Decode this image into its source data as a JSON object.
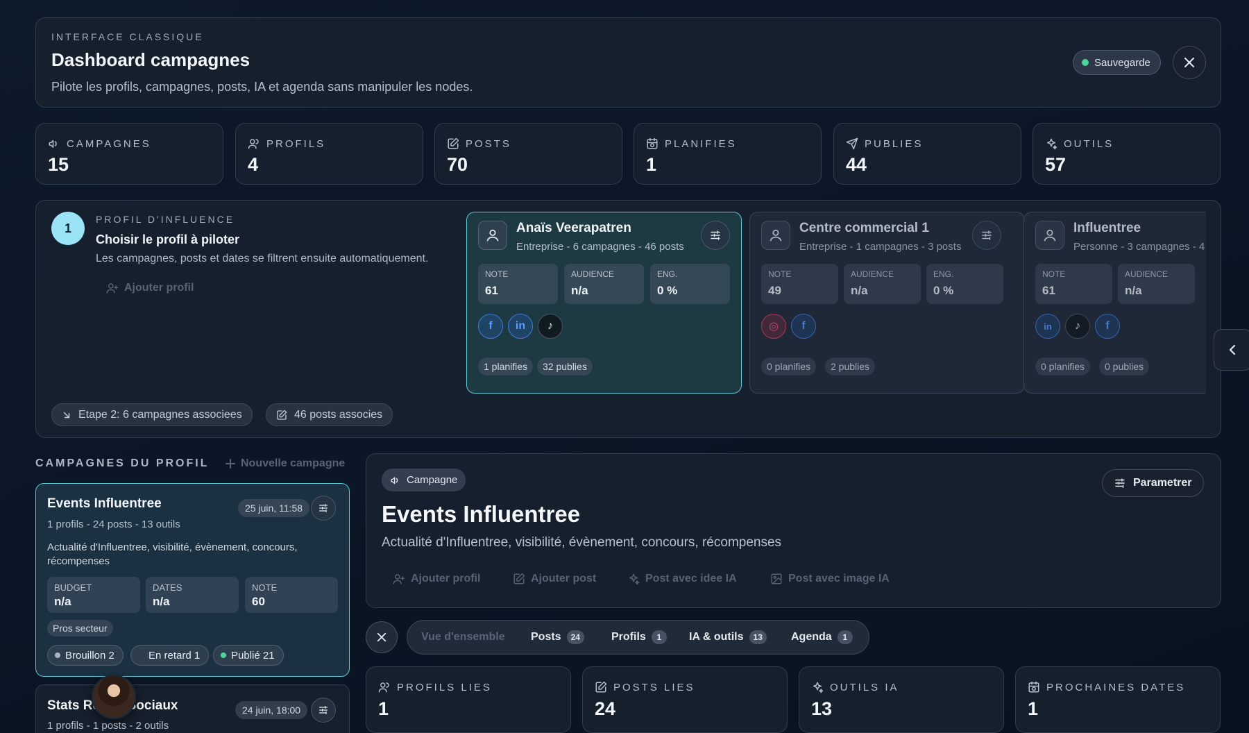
{
  "header": {
    "eyebrow": "INTERFACE CLASSIQUE",
    "title": "Dashboard campagnes",
    "subtitle": "Pilote les profils, campagnes, posts, IA et agenda sans manipuler les nodes.",
    "save_label": "Sauvegarde",
    "save_status_color": "#4cd59a"
  },
  "stats": [
    {
      "label": "CAMPAGNES",
      "value": "15",
      "icon": "megaphone-icon"
    },
    {
      "label": "PROFILS",
      "value": "4",
      "icon": "users-icon"
    },
    {
      "label": "POSTS",
      "value": "70",
      "icon": "edit-icon"
    },
    {
      "label": "PLANIFIES",
      "value": "1",
      "icon": "calendar-clock-icon"
    },
    {
      "label": "PUBLIES",
      "value": "44",
      "icon": "send-icon"
    },
    {
      "label": "OUTILS",
      "value": "57",
      "icon": "sparkles-icon"
    }
  ],
  "profile_section": {
    "step": "1",
    "eyebrow": "PROFIL D'INFLUENCE",
    "title": "Choisir le profil à piloter",
    "subtitle": "Les campagnes, posts et dates se filtrent ensuite automatiquement.",
    "add_label": "Ajouter profil",
    "step2_label": "Etape 2: 6 campagnes associees",
    "posts_label": "46 posts associes",
    "profiles": [
      {
        "name": "Anaïs Veerapatren",
        "meta": "Entreprise - 6 campagnes - 46 posts",
        "stats": [
          {
            "label": "NOTE",
            "value": "61"
          },
          {
            "label": "AUDIENCE",
            "value": "n/a"
          },
          {
            "label": "ENG.",
            "value": "0 %"
          }
        ],
        "socials": [
          "facebook",
          "linkedin",
          "tiktok"
        ],
        "chips": [
          "1 planifies",
          "32 publies"
        ]
      },
      {
        "name": "Centre commercial 1",
        "meta": "Entreprise - 1 campagnes - 3 posts",
        "stats": [
          {
            "label": "NOTE",
            "value": "49"
          },
          {
            "label": "AUDIENCE",
            "value": "n/a"
          },
          {
            "label": "ENG.",
            "value": "0 %"
          }
        ],
        "socials": [
          "instagram",
          "facebook"
        ],
        "chips": [
          "0 planifies",
          "2 publies"
        ]
      },
      {
        "name": "Influentree",
        "meta": "Personne - 3 campagnes - 4",
        "stats": [
          {
            "label": "NOTE",
            "value": "61"
          },
          {
            "label": "AUDIENCE",
            "value": "n/a"
          }
        ],
        "socials": [
          "linkedin",
          "tiktok",
          "facebook"
        ],
        "chips": [
          "0 planifies",
          "0 publies"
        ]
      }
    ]
  },
  "campaigns_list": {
    "heading": "CAMPAGNES DU PROFIL",
    "new_label": "Nouvelle campagne",
    "items": [
      {
        "title": "Events Influentree",
        "date": "25 juin, 11:58",
        "meta": "1 profils - 24 posts - 13 outils",
        "desc": "Actualité d'Influentree, visibilité, évènement, concours, récompenses",
        "stats": [
          {
            "label": "BUDGET",
            "value": "n/a"
          },
          {
            "label": "DATES",
            "value": "n/a"
          },
          {
            "label": "NOTE",
            "value": "60"
          }
        ],
        "tag": "Pros secteur",
        "statuses": [
          {
            "label": "Brouillon 2",
            "color": "#aab4c0"
          },
          {
            "label": "En retard 1",
            "color": ""
          },
          {
            "label": "Publié 21",
            "color": "#4cd59a"
          }
        ]
      },
      {
        "title": "Stats Re",
        "title_end": "t Sociaux",
        "date": "24 juin, 18:00",
        "meta": "1 profils - 1 posts - 2 outils"
      }
    ]
  },
  "campaign_detail": {
    "badge": "Campagne",
    "title": "Events Influentree",
    "desc": "Actualité d'Influentree, visibilité, évènement, concours, récompenses",
    "param_label": "Parametrer",
    "actions": [
      {
        "label": "Ajouter profil",
        "icon": "user-plus-icon"
      },
      {
        "label": "Ajouter post",
        "icon": "edit-icon"
      },
      {
        "label": "Post avec idee IA",
        "icon": "sparkles-icon"
      },
      {
        "label": "Post avec image IA",
        "icon": "image-icon"
      }
    ]
  },
  "tabs": [
    {
      "label": "Vue d'ensemble",
      "count": ""
    },
    {
      "label": "Posts",
      "count": "24"
    },
    {
      "label": "Profils",
      "count": "1"
    },
    {
      "label": "IA & outils",
      "count": "13"
    },
    {
      "label": "Agenda",
      "count": "1"
    }
  ],
  "lower_stats": [
    {
      "label": "PROFILS LIES",
      "value": "1",
      "icon": "users-icon"
    },
    {
      "label": "POSTS LIES",
      "value": "24",
      "icon": "edit-icon"
    },
    {
      "label": "OUTILS IA",
      "value": "13",
      "icon": "sparkles-icon"
    },
    {
      "label": "PROCHAINES DATES",
      "value": "1",
      "icon": "calendar-clock-icon"
    }
  ]
}
